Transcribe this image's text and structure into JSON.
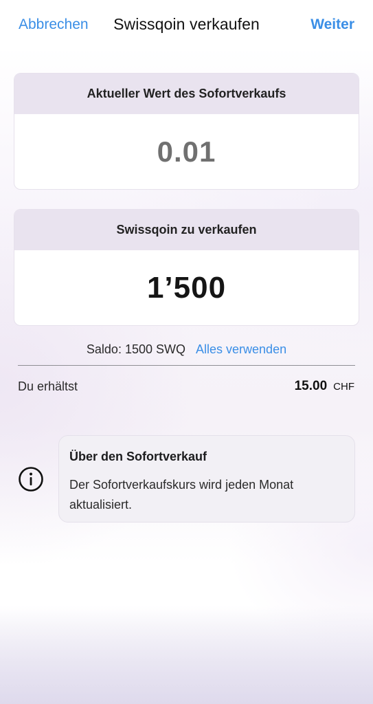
{
  "nav": {
    "cancel_label": "Abbrechen",
    "title": "Swissqoin verkaufen",
    "next_label": "Weiter"
  },
  "instant_value_card": {
    "header": "Aktueller Wert des Sofortverkaufs",
    "value": "0.01"
  },
  "sell_amount_card": {
    "header": "Swissqoin zu verkaufen",
    "value": "1’500"
  },
  "balance": {
    "text": "Saldo: 1500 SWQ",
    "use_all_label": "Alles verwenden"
  },
  "receive": {
    "label": "Du erhältst",
    "amount": "15.00",
    "currency": "CHF"
  },
  "info": {
    "icon": "info-circle-icon",
    "title": "Über den Sofortverkauf",
    "text": "Der Sofortverkaufskurs wird jeden Monat aktualisiert."
  },
  "colors": {
    "accent": "#3a8ee6",
    "card_header": "#e9e3ef",
    "muted_value": "#707070"
  }
}
